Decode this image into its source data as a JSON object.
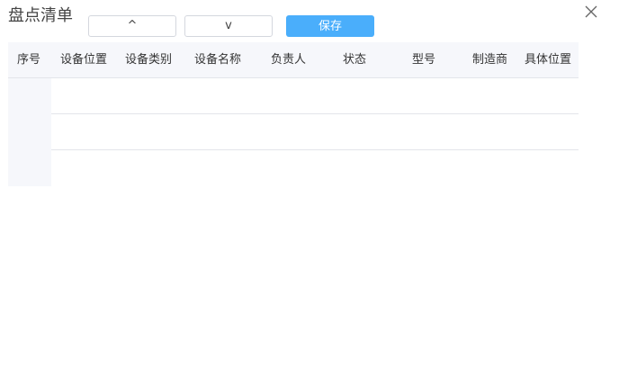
{
  "header": {
    "title": "盘点清单",
    "up_label": "^",
    "down_label": "v",
    "save_label": "保存"
  },
  "table": {
    "columns": [
      "序号",
      "设备位置",
      "设备类别",
      "设备名称",
      "负责人",
      "状态",
      "型号",
      "制造商",
      "具体位置"
    ],
    "rows": [
      [],
      [],
      []
    ]
  }
}
